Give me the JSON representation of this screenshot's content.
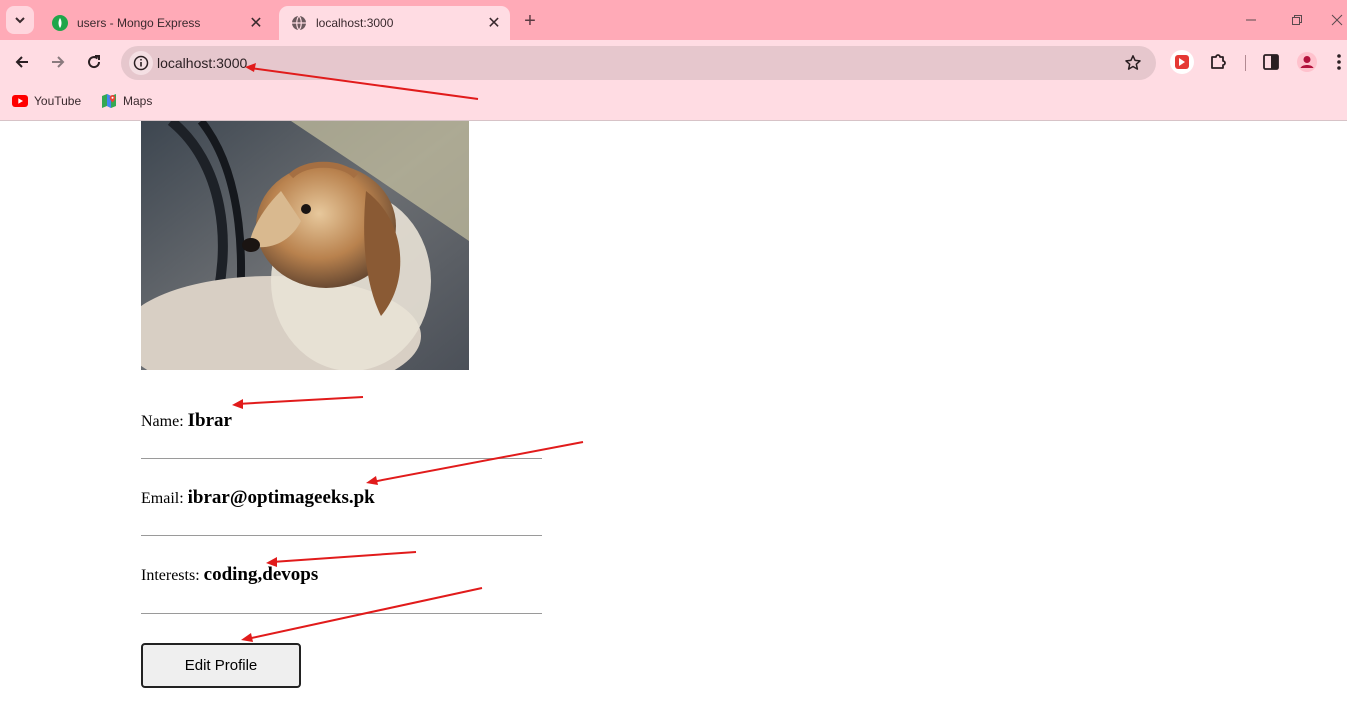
{
  "browser": {
    "tabs": [
      {
        "title": "users - Mongo Express",
        "favicon": "mongodb-leaf-icon",
        "active": false
      },
      {
        "title": "localhost:3000",
        "favicon": "globe-icon",
        "active": true
      }
    ],
    "address_bar": {
      "url": "localhost:3000"
    },
    "bookmarks": [
      {
        "label": "YouTube",
        "icon": "youtube-icon"
      },
      {
        "label": "Maps",
        "icon": "maps-icon"
      }
    ],
    "colors": {
      "tabstrip": "#ffaab7",
      "toolbar": "#ffdce3",
      "omnibox": "#e6c7cd"
    }
  },
  "profile": {
    "photo_alt": "dog photo",
    "name_label": "Name:",
    "name_value": "Ibrar",
    "email_label": "Email:",
    "email_value": "ibrar@optimageeks.pk",
    "interests_label": "Interests:",
    "interests_value": "coding,devops",
    "edit_button": "Edit Profile"
  },
  "annotations": {
    "color": "#e11b1b",
    "count": 5
  }
}
